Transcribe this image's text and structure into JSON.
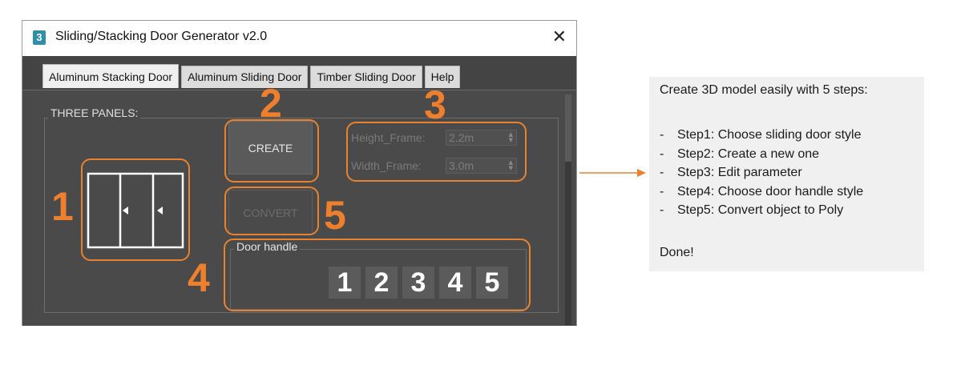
{
  "window": {
    "app_icon_text": "3",
    "title": "Sliding/Stacking Door Generator v2.0",
    "close_symbol": "✕"
  },
  "tabs": [
    {
      "label": "Aluminum Stacking Door",
      "active": true
    },
    {
      "label": "Aluminum Sliding Door",
      "active": false
    },
    {
      "label": "Timber Sliding Door",
      "active": false
    },
    {
      "label": "Help",
      "active": false
    }
  ],
  "panel": {
    "group_label": "THREE PANELS:",
    "create_label": "CREATE",
    "convert_label": "CONVERT",
    "height_label": "Height_Frame:",
    "height_value": "2.2m",
    "width_label": "Width_Frame:",
    "width_value": "3.0m",
    "door_handle_label": "Door handle",
    "handle_options": [
      "1",
      "2",
      "3",
      "4",
      "5"
    ]
  },
  "annotations": {
    "step_numbers": [
      "1",
      "2",
      "3",
      "4",
      "5"
    ],
    "accent_color": "#ee7f2d"
  },
  "info": {
    "title": "Create 3D model easily with 5 steps:",
    "dash": "-",
    "steps": [
      "Step1: Choose sliding door style",
      "Step2: Create a new one",
      "Step3: Edit parameter",
      "Step4: Choose door handle style",
      "Step5: Convert object to Poly"
    ],
    "done": "Done!"
  }
}
